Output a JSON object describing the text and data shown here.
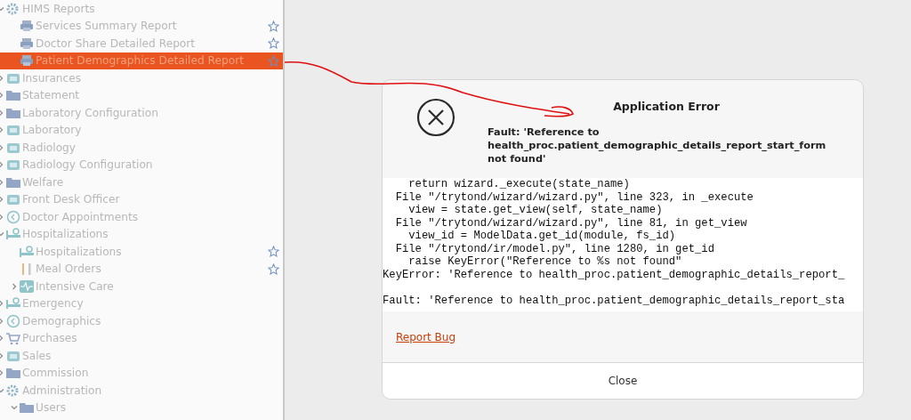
{
  "sidebar": {
    "items": [
      {
        "label": "HIMS Reports",
        "expanded": true,
        "selected": false,
        "children": [
          {
            "label": "Services Summary Report",
            "selected": false
          },
          {
            "label": "Doctor Share Detailed Report",
            "selected": false
          },
          {
            "label": "Patient Demographics Detailed Report",
            "selected": true
          }
        ]
      },
      {
        "label": "Insurances",
        "expanded": false,
        "selected": false
      },
      {
        "label": "Statement",
        "expanded": false,
        "selected": false
      },
      {
        "label": "Laboratory Configuration",
        "expanded": false,
        "selected": false
      },
      {
        "label": "Laboratory",
        "expanded": false,
        "selected": false
      },
      {
        "label": "Radiology",
        "expanded": false,
        "selected": false
      },
      {
        "label": "Radiology Configuration",
        "expanded": false,
        "selected": false
      },
      {
        "label": "Welfare",
        "expanded": false,
        "selected": false
      },
      {
        "label": "Front Desk Officer",
        "expanded": false,
        "selected": false
      },
      {
        "label": "Doctor Appointments",
        "expanded": false,
        "selected": false
      },
      {
        "label": "Hospitalizations",
        "expanded": true,
        "selected": false,
        "children": [
          {
            "label": "Hospitalizations",
            "selected": false
          },
          {
            "label": "Meal Orders",
            "selected": false
          },
          {
            "label": "Intensive Care",
            "expanded": false,
            "selected": false
          }
        ]
      },
      {
        "label": "Emergency",
        "expanded": false,
        "selected": false
      },
      {
        "label": "Demographics",
        "expanded": false,
        "selected": false
      },
      {
        "label": "Purchases",
        "expanded": false,
        "selected": false
      },
      {
        "label": "Sales",
        "expanded": false,
        "selected": false
      },
      {
        "label": "Commission",
        "expanded": false,
        "selected": false
      },
      {
        "label": "Administration",
        "expanded": true,
        "selected": false,
        "children": [
          {
            "label": "Users",
            "expanded": true,
            "selected": false
          }
        ]
      }
    ]
  },
  "dialog": {
    "title": "Application Error",
    "message": "Fault: 'Reference to health_proc.patient_demographic_details_report_start_form not found'",
    "traceback": [
      [
        "    return wizard._execute(state_name)",
        "  File \"/trytond/wizard/wizard.py\", line 323, in _execute",
        "    view = state.get_view(self, state_name)",
        "  File \"/trytond/wizard/wizard.py\", line 81, in get_view",
        "    view_id = ModelData.get_id(module, fs_id)",
        "  File \"/trytond/ir/model.py\", line 1280, in get_id",
        "    raise KeyError(\"Reference to %s not found\"",
        "KeyError: 'Reference to health_proc.patient_demographic_details_report_"
      ],
      [
        "Fault: 'Reference to health_proc.patient_demographic_details_report_sta"
      ]
    ],
    "link": "Report Bug",
    "button": "Close"
  }
}
